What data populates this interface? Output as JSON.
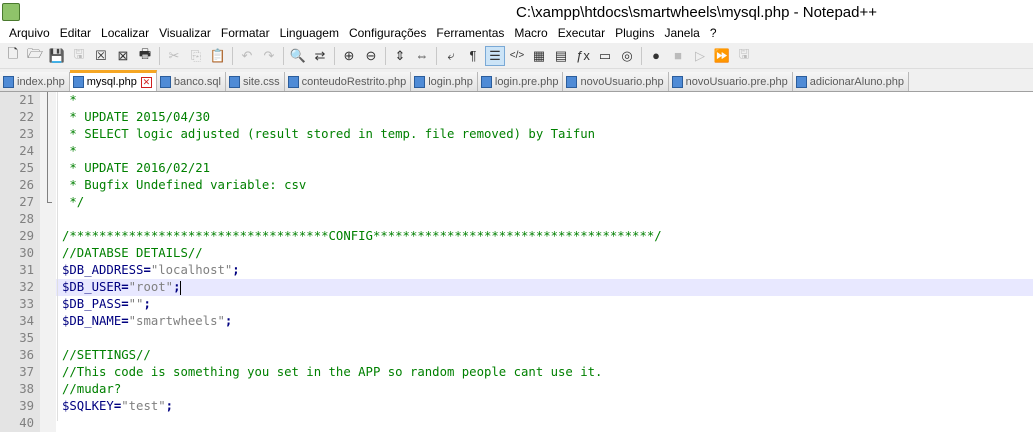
{
  "window": {
    "title": "C:\\xampp\\htdocs\\smartwheels\\mysql.php - Notepad++"
  },
  "menu": [
    "Arquivo",
    "Editar",
    "Localizar",
    "Visualizar",
    "Formatar",
    "Linguagem",
    "Configurações",
    "Ferramentas",
    "Macro",
    "Executar",
    "Plugins",
    "Janela",
    "?"
  ],
  "toolbar": [
    {
      "name": "new-file-icon",
      "glyph": "🗋"
    },
    {
      "name": "open-file-icon",
      "glyph": "🗁"
    },
    {
      "name": "save-icon",
      "glyph": "💾",
      "dim": true
    },
    {
      "name": "save-all-icon",
      "glyph": "🖫",
      "dim": true
    },
    {
      "name": "close-icon",
      "glyph": "☒"
    },
    {
      "name": "close-all-icon",
      "glyph": "⊠"
    },
    {
      "name": "print-icon",
      "glyph": "🖶"
    },
    {
      "sep": true
    },
    {
      "name": "cut-icon",
      "glyph": "✂",
      "dim": true
    },
    {
      "name": "copy-icon",
      "glyph": "⎘",
      "dim": true
    },
    {
      "name": "paste-icon",
      "glyph": "📋",
      "dim": true
    },
    {
      "sep": true
    },
    {
      "name": "undo-icon",
      "glyph": "↶",
      "dim": true
    },
    {
      "name": "redo-icon",
      "glyph": "↷",
      "dim": true
    },
    {
      "sep": true
    },
    {
      "name": "find-icon",
      "glyph": "🔍"
    },
    {
      "name": "replace-icon",
      "glyph": "⇄"
    },
    {
      "sep": true
    },
    {
      "name": "zoom-in-icon",
      "glyph": "⊕"
    },
    {
      "name": "zoom-out-icon",
      "glyph": "⊖"
    },
    {
      "sep": true
    },
    {
      "name": "sync-vertical-icon",
      "glyph": "⇕"
    },
    {
      "name": "sync-horizontal-icon",
      "glyph": "⇔"
    },
    {
      "sep": true
    },
    {
      "name": "word-wrap-icon",
      "glyph": "⤶"
    },
    {
      "name": "show-all-chars-icon",
      "glyph": "¶"
    },
    {
      "name": "indent-guide-icon",
      "glyph": "☰",
      "on": true
    },
    {
      "name": "code-icon",
      "glyph": "</>"
    },
    {
      "name": "doc-map-icon",
      "glyph": "▦"
    },
    {
      "name": "folder-workspace-icon",
      "glyph": "▤"
    },
    {
      "name": "function-list-icon",
      "glyph": "ƒx"
    },
    {
      "name": "monitor-icon",
      "glyph": "▭"
    },
    {
      "name": "camera-icon",
      "glyph": "◎"
    },
    {
      "sep": true
    },
    {
      "name": "record-macro-icon",
      "glyph": "●"
    },
    {
      "name": "stop-macro-icon",
      "glyph": "■",
      "dim": true
    },
    {
      "name": "play-macro-icon",
      "glyph": "▷",
      "dim": true
    },
    {
      "name": "play-multiple-icon",
      "glyph": "⏩"
    },
    {
      "name": "save-macro-icon",
      "glyph": "🖫",
      "dim": true
    }
  ],
  "tabs": [
    {
      "label": "index.php",
      "active": false
    },
    {
      "label": "mysql.php",
      "active": true
    },
    {
      "label": "banco.sql",
      "active": false
    },
    {
      "label": "site.css",
      "active": false
    },
    {
      "label": "conteudoRestrito.php",
      "active": false
    },
    {
      "label": "login.php",
      "active": false
    },
    {
      "label": "login.pre.php",
      "active": false
    },
    {
      "label": "novoUsuario.php",
      "active": false
    },
    {
      "label": "novoUsuario.pre.php",
      "active": false
    },
    {
      "label": "adicionarAluno.php",
      "active": false
    }
  ],
  "lines": [
    {
      "num": "21",
      "parts": [
        {
          "t": " *",
          "c": "cm"
        }
      ]
    },
    {
      "num": "22",
      "parts": [
        {
          "t": " * UPDATE 2015/04/30",
          "c": "cm"
        }
      ]
    },
    {
      "num": "23",
      "parts": [
        {
          "t": " * SELECT logic adjusted (result stored in temp. file removed) by Taifun",
          "c": "cm"
        }
      ]
    },
    {
      "num": "24",
      "parts": [
        {
          "t": " *",
          "c": "cm"
        }
      ]
    },
    {
      "num": "25",
      "parts": [
        {
          "t": " * UPDATE 2016/02/21",
          "c": "cm"
        }
      ]
    },
    {
      "num": "26",
      "parts": [
        {
          "t": " * Bugfix Undefined variable: csv",
          "c": "cm"
        }
      ]
    },
    {
      "num": "27",
      "parts": [
        {
          "t": " */",
          "c": "cm"
        }
      ]
    },
    {
      "num": "28",
      "parts": []
    },
    {
      "num": "29",
      "parts": [
        {
          "t": "/***********************************CONFIG**************************************/",
          "c": "cm"
        }
      ]
    },
    {
      "num": "30",
      "parts": [
        {
          "t": "//DATABSE DETAILS//",
          "c": "cm"
        }
      ]
    },
    {
      "num": "31",
      "parts": [
        {
          "t": "$DB_ADDRESS",
          "c": "var"
        },
        {
          "t": "=",
          "c": "op"
        },
        {
          "t": "\"localhost\"",
          "c": "str"
        },
        {
          "t": ";",
          "c": "op"
        }
      ]
    },
    {
      "num": "32",
      "parts": [
        {
          "t": "$DB_USER",
          "c": "var"
        },
        {
          "t": "=",
          "c": "op"
        },
        {
          "t": "\"root\"",
          "c": "str"
        },
        {
          "t": ";",
          "c": "op"
        }
      ],
      "current": true
    },
    {
      "num": "33",
      "parts": [
        {
          "t": "$DB_PASS",
          "c": "var"
        },
        {
          "t": "=",
          "c": "op"
        },
        {
          "t": "\"\"",
          "c": "str"
        },
        {
          "t": ";",
          "c": "op"
        }
      ]
    },
    {
      "num": "34",
      "parts": [
        {
          "t": "$DB_NAME",
          "c": "var"
        },
        {
          "t": "=",
          "c": "op"
        },
        {
          "t": "\"smartwheels\"",
          "c": "str"
        },
        {
          "t": ";",
          "c": "op"
        }
      ]
    },
    {
      "num": "35",
      "parts": []
    },
    {
      "num": "36",
      "parts": [
        {
          "t": "//SETTINGS//",
          "c": "cm"
        }
      ]
    },
    {
      "num": "37",
      "parts": [
        {
          "t": "//This code is something you set in the APP so random people cant use it.",
          "c": "cm"
        }
      ]
    },
    {
      "num": "38",
      "parts": [
        {
          "t": "//mudar?",
          "c": "cm"
        }
      ]
    },
    {
      "num": "39",
      "parts": [
        {
          "t": "$SQLKEY",
          "c": "var"
        },
        {
          "t": "=",
          "c": "op"
        },
        {
          "t": "\"test\"",
          "c": "str"
        },
        {
          "t": ";",
          "c": "op"
        }
      ]
    },
    {
      "num": "40",
      "parts": []
    }
  ]
}
